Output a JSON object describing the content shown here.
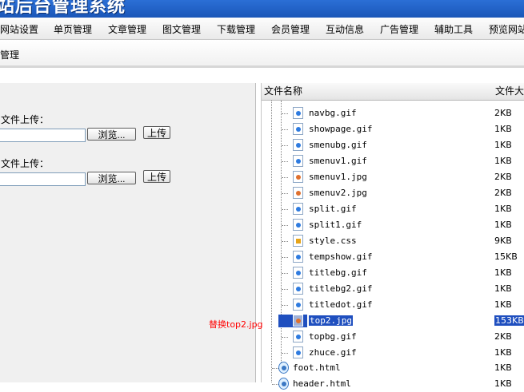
{
  "header": {
    "title": "站后台管理系统"
  },
  "nav": [
    {
      "label": "网站设置"
    },
    {
      "label": "单页管理"
    },
    {
      "label": "文章管理"
    },
    {
      "label": "图文管理"
    },
    {
      "label": "下载管理"
    },
    {
      "label": "会员管理"
    },
    {
      "label": "互动信息"
    },
    {
      "label": "广告管理"
    },
    {
      "label": "辅助工具"
    },
    {
      "label": "预览网站"
    }
  ],
  "subbar": {
    "label": "管理"
  },
  "upload": [
    {
      "label": "文件上传：",
      "browse": "浏览...",
      "submit": "上传"
    },
    {
      "label": "文件上传：",
      "browse": "浏览...",
      "submit": "上传"
    }
  ],
  "file_list": {
    "col_name": "文件名称",
    "col_size": "文件大小",
    "files": [
      {
        "name": "navbg.gif",
        "size": "2KB",
        "icon": "gif-file-icon"
      },
      {
        "name": "showpage.gif",
        "size": "1KB",
        "icon": "gif-file-icon"
      },
      {
        "name": "smenubg.gif",
        "size": "1KB",
        "icon": "gif-file-icon"
      },
      {
        "name": "smenuv1.gif",
        "size": "1KB",
        "icon": "gif-file-icon"
      },
      {
        "name": "smenuv1.jpg",
        "size": "2KB",
        "icon": "jpg-file-icon"
      },
      {
        "name": "smenuv2.jpg",
        "size": "2KB",
        "icon": "jpg-file-icon"
      },
      {
        "name": "split.gif",
        "size": "1KB",
        "icon": "gif-file-icon"
      },
      {
        "name": "split1.gif",
        "size": "1KB",
        "icon": "gif-file-icon"
      },
      {
        "name": "style.css",
        "size": "9KB",
        "icon": "css-file-icon"
      },
      {
        "name": "tempshow.gif",
        "size": "15KB",
        "icon": "gif-file-icon"
      },
      {
        "name": "titlebg.gif",
        "size": "1KB",
        "icon": "gif-file-icon"
      },
      {
        "name": "titlebg2.gif",
        "size": "1KB",
        "icon": "gif-file-icon"
      },
      {
        "name": "titledot.gif",
        "size": "1KB",
        "icon": "gif-file-icon"
      },
      {
        "name": "top2.jpg",
        "size": "153KB",
        "icon": "jpg-file-icon",
        "selected": true
      },
      {
        "name": "topbg.gif",
        "size": "2KB",
        "icon": "gif-file-icon"
      },
      {
        "name": "zhuce.gif",
        "size": "1KB",
        "icon": "gif-file-icon"
      },
      {
        "name": "foot.html",
        "size": "1KB",
        "icon": "html-file-icon"
      },
      {
        "name": "header.html",
        "size": "1KB",
        "icon": "html-file-icon"
      }
    ]
  },
  "annotation": "替换top2.jpg",
  "colors": {
    "header_bg": "#1a56b8",
    "selection": "#1f4fbf",
    "annotation": "#ff0000"
  }
}
